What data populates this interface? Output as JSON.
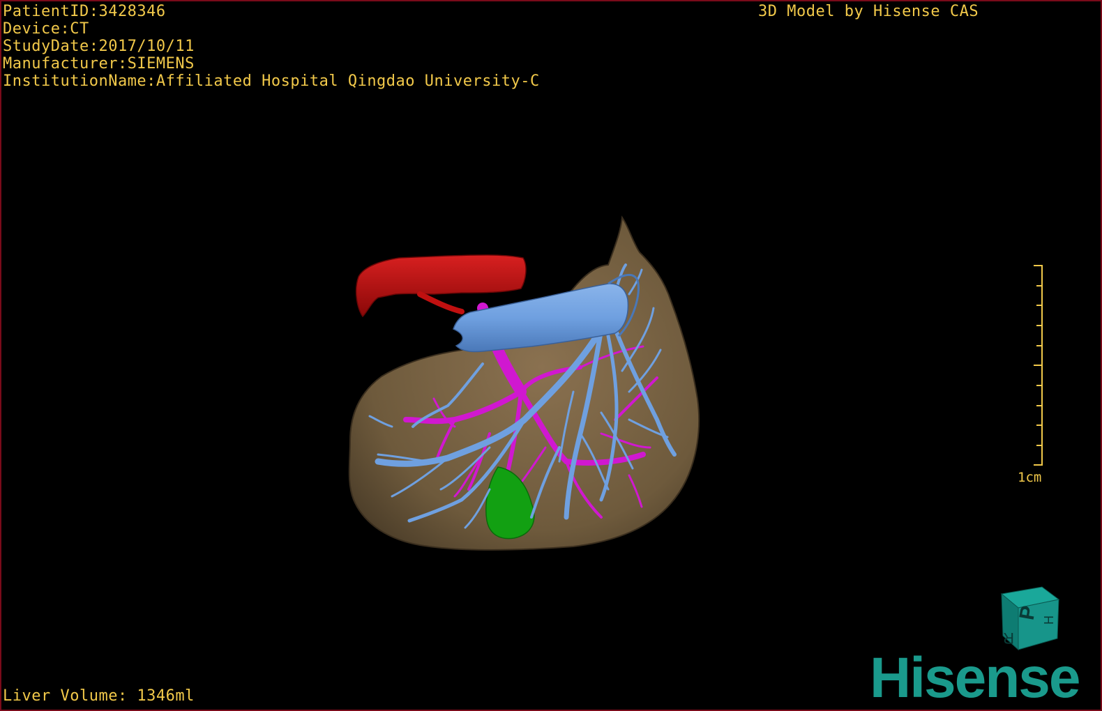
{
  "overlay": {
    "patient_id": "PatientID:3428346",
    "device": "Device:CT",
    "study_date": "StudyDate:2017/10/11",
    "manufacturer": "Manufacturer:SIEMENS",
    "institution": "InstitutionName:Affiliated Hospital Qingdao University-C"
  },
  "brand_caption": "3D Model by Hisense CAS",
  "liver_volume": "Liver Volume: 1346ml",
  "scale_bar": {
    "label": "1cm"
  },
  "orientation_cube": {
    "face_letter": "P",
    "side_letters": [
      "R",
      "H"
    ]
  },
  "logo": "Hisense",
  "colors": {
    "overlay_text": "#f2c94a",
    "liver": "#7a6444",
    "artery": "#c01010",
    "portal_vein": "#d018d0",
    "hepatic_vein": "#6fa0e0",
    "gallbladder": "#10a010",
    "brand": "#1a9a8c",
    "border": "#7a0a1a"
  }
}
